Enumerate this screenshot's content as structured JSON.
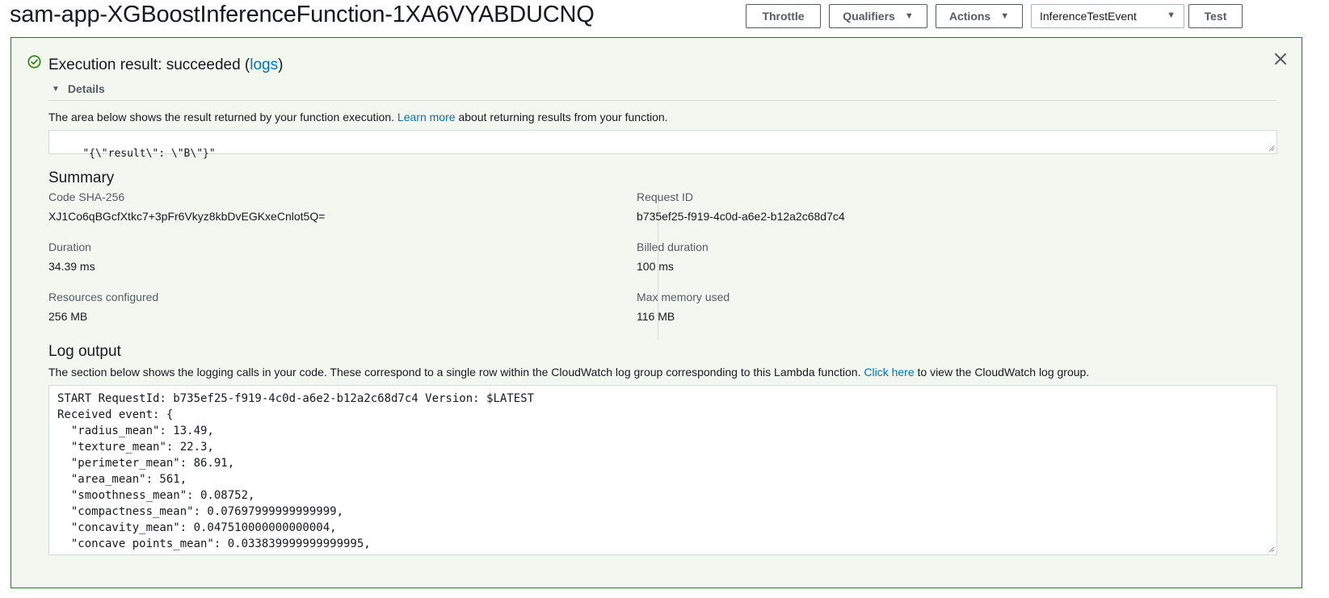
{
  "header": {
    "title": "sam-app-XGBoostInferenceFunction-1XA6VYABDUCNQ",
    "throttle_label": "Throttle",
    "qualifiers_label": "Qualifiers",
    "actions_label": "Actions",
    "test_event_selected": "InferenceTestEvent",
    "test_label": "Test"
  },
  "execution": {
    "title_prefix": "Execution result: succeeded (",
    "logs_link": "logs",
    "title_suffix": ")",
    "status_color": "#1d8102",
    "details_label": "Details",
    "desc_prefix": "The area below shows the result returned by your function execution.",
    "learn_more_link": "Learn more",
    "desc_suffix": "about returning results from your function.",
    "result_value": "\"{\\\"result\\\": \\\"B\\\"}\""
  },
  "summary": {
    "title": "Summary",
    "code_sha_label": "Code SHA-256",
    "code_sha_value": "XJ1Co6qBGcfXtkc7+3pFr6Vkyz8kbDvEGKxeCnlot5Q=",
    "request_id_label": "Request ID",
    "request_id_value": "b735ef25-f919-4c0d-a6e2-b12a2c68d7c4",
    "duration_label": "Duration",
    "duration_value": "34.39 ms",
    "billed_duration_label": "Billed duration",
    "billed_duration_value": "100 ms",
    "resources_label": "Resources configured",
    "resources_value": "256 MB",
    "max_memory_label": "Max memory used",
    "max_memory_value": "116 MB"
  },
  "log": {
    "title": "Log output",
    "desc_prefix": "The section below shows the logging calls in your code. These correspond to a single row within the CloudWatch log group corresponding to this Lambda function.",
    "click_here_link": "Click here",
    "desc_suffix": "to view the CloudWatch log group.",
    "content": "START RequestId: b735ef25-f919-4c0d-a6e2-b12a2c68d7c4 Version: $LATEST\nReceived event: {\n  \"radius_mean\": 13.49,\n  \"texture_mean\": 22.3,\n  \"perimeter_mean\": 86.91,\n  \"area_mean\": 561,\n  \"smoothness_mean\": 0.08752,\n  \"compactness_mean\": 0.07697999999999999,\n  \"concavity_mean\": 0.047510000000000004,\n  \"concave points_mean\": 0.033839999999999995,"
  }
}
